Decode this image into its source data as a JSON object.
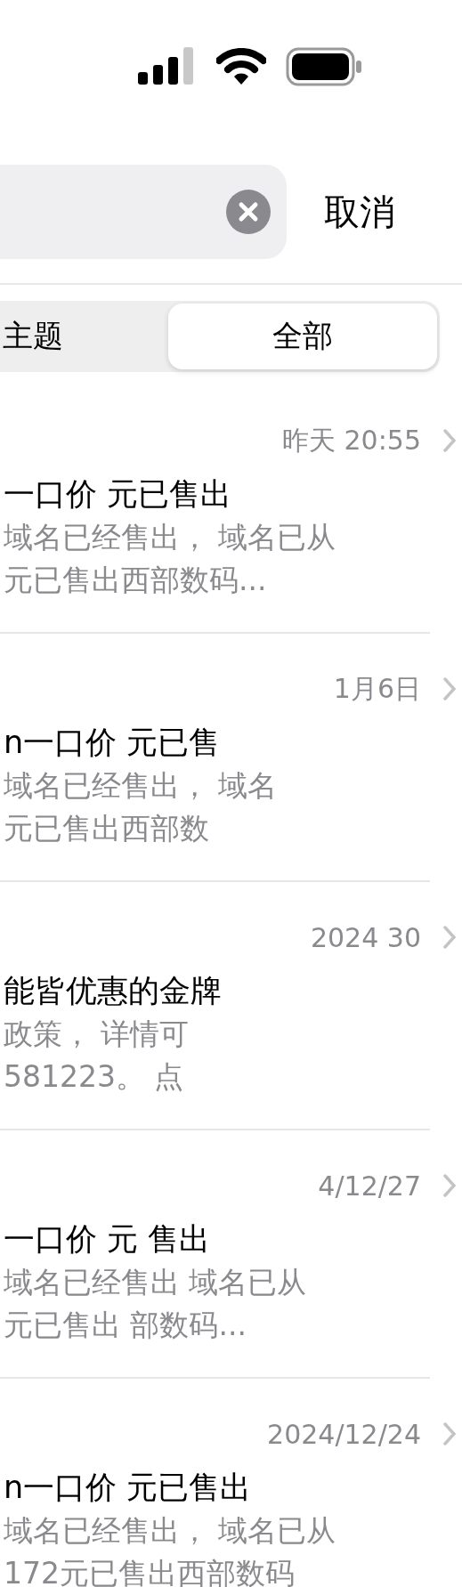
{
  "search": {
    "cancel": "取消"
  },
  "segments": [
    {
      "label": "主题",
      "selected": false
    },
    {
      "label": "全部",
      "selected": true
    }
  ],
  "results": [
    {
      "date": "昨天 20:55",
      "title": "一口价  元已售出",
      "preview": [
        "域名已经售出， 域名已从",
        "元已售出西部数码..."
      ]
    },
    {
      "date": "1月6日",
      "title": "n一口价  元已售",
      "preview": [
        "域名已经售出， 域名",
        "元已售出西部数"
      ]
    },
    {
      "date": "2024  30",
      "title": "能皆优惠的金牌",
      "preview": [
        "政策， 详情可",
        "581223。 点"
      ]
    },
    {
      "date": "4/12/27",
      "title": "一口价  元 售出",
      "preview": [
        "域名已经售出 域名已从",
        "元已售出 部数码..."
      ]
    },
    {
      "date": "2024/12/24",
      "title": "n一口价  元已售出",
      "preview": [
        "域名已经售出， 域名已从",
        "172元已售出西部数码"
      ]
    }
  ]
}
